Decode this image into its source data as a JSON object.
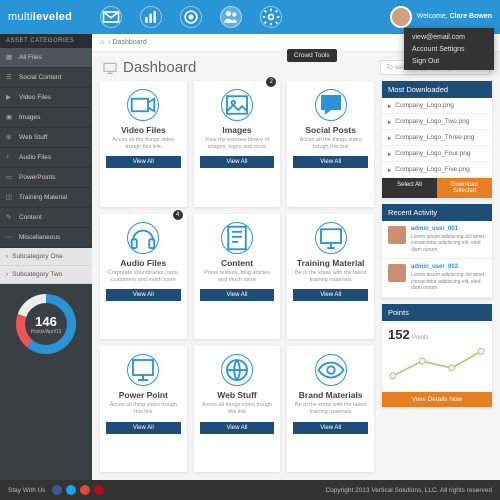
{
  "brand": {
    "pre": "multi",
    "post": "leveled"
  },
  "user": {
    "welcome_pre": "Welcome,",
    "name": "Clare Bowen",
    "email": "view@email.com",
    "menu": {
      "settings": "Account Settigns",
      "signout": "Sign Out"
    }
  },
  "crumb": {
    "home": "Dashboard",
    "tooltip": "Crowd Tools"
  },
  "page_title": "Dashboard",
  "search": {
    "placeholder": "To search begin typing..."
  },
  "sidebar": {
    "header": "ASSET CATEGORIES",
    "items": [
      {
        "label": "All Files"
      },
      {
        "label": "Social Content"
      },
      {
        "label": "Video Files"
      },
      {
        "label": "Images"
      },
      {
        "label": "Web Stuff"
      },
      {
        "label": "Audio Files"
      },
      {
        "label": "PowerPoints"
      },
      {
        "label": "Training Material"
      },
      {
        "label": "Content"
      },
      {
        "label": "Miscellaneous"
      }
    ],
    "subs": [
      {
        "label": "Subcategory One"
      },
      {
        "label": "Subcategory Two"
      }
    ],
    "gauge": {
      "value": "146",
      "label": "Points/April13"
    }
  },
  "cards": [
    {
      "title": "Video Files",
      "desc": "Acces all the things video trough this link"
    },
    {
      "title": "Images",
      "desc": "View the extense library of images, logos and more"
    },
    {
      "title": "Social Posts",
      "desc": "Acces all the things video trough this link"
    },
    {
      "title": "Audio Files",
      "desc": "Corporate soundtracks, raps, customers and much more"
    },
    {
      "title": "Content",
      "desc": "Press releses, blog articles and much more"
    },
    {
      "title": "Training Material",
      "desc": "Be in the know with the latest training materials"
    },
    {
      "title": "Power Point",
      "desc": "Acces all thing video trough this link"
    },
    {
      "title": "Web Stuff",
      "desc": "Acces all things video trough this link"
    },
    {
      "title": "Brand Materials",
      "desc": "Be in the know with the latest training materials"
    }
  ],
  "view_all": "View All",
  "badges": {
    "images": "2",
    "audio": "4"
  },
  "downloads": {
    "title": "Most Downloaded",
    "items": [
      "Company_Logo.png",
      "Company_Logo_Two.png",
      "Company_Logo_Three.png",
      "Company_Logo_Four.png",
      "Company_Logo_Five.png"
    ],
    "select_all": "Select All",
    "download_sel": "Download Selected"
  },
  "activity": {
    "title": "Recent Activity",
    "items": [
      {
        "user": "admin_user_001",
        "text": "Lorem ipsum adipiscing dol amet, consectetur adipiscing elit, eled diam norum"
      },
      {
        "user": "admin_user_002",
        "text": "Lorem ipsum adipiscing dol amet, consectetur adipiscing elit, eled diam norum"
      }
    ]
  },
  "points": {
    "title": "Points",
    "value": "152",
    "label": "Points",
    "view": "View Details Now"
  },
  "footer": {
    "stay": "Stay With Us",
    "copy": "Copyright 2013 Vertical Solutions, LLC. All rights reserved"
  },
  "chart_data": {
    "type": "line",
    "x": [
      0,
      1,
      2,
      3
    ],
    "values": [
      30,
      60,
      45,
      85
    ],
    "ylim": [
      0,
      100
    ]
  }
}
